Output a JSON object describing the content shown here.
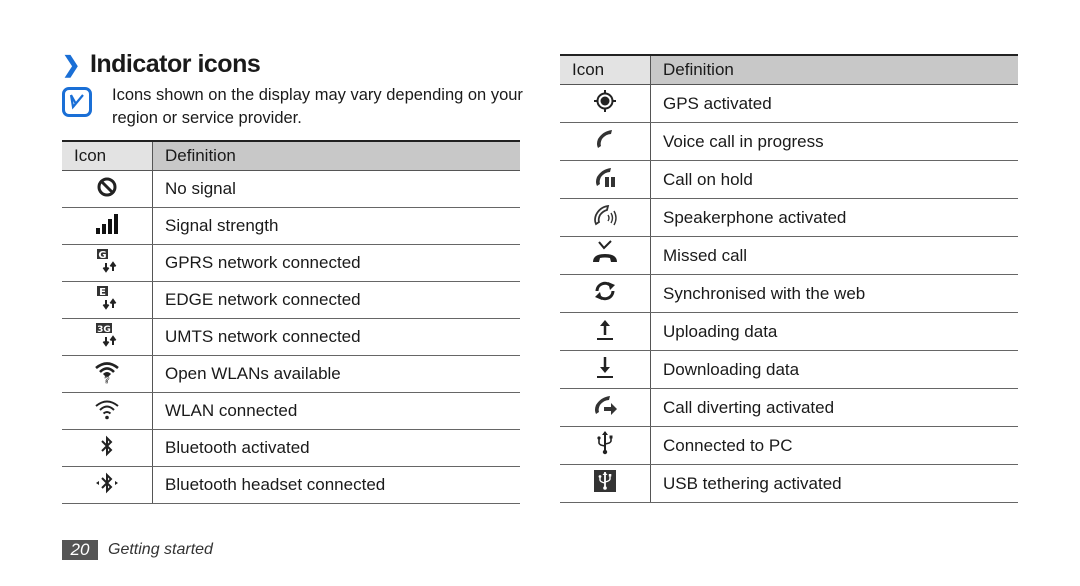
{
  "section": {
    "title_marker": "❯",
    "title": "Indicator icons",
    "note_icon": "note-pencil-icon",
    "note_text": "Icons shown on the display may vary depending on your region or service provider."
  },
  "table_headers": {
    "icon": "Icon",
    "definition": "Definition"
  },
  "left_table": [
    {
      "icon": "no-signal-icon",
      "definition": "No signal"
    },
    {
      "icon": "signal-strength-icon",
      "definition": "Signal strength"
    },
    {
      "icon": "gprs-icon",
      "definition": "GPRS network connected"
    },
    {
      "icon": "edge-icon",
      "definition": "EDGE network connected"
    },
    {
      "icon": "umts-icon",
      "definition": "UMTS network connected"
    },
    {
      "icon": "open-wlan-icon",
      "definition": "Open WLANs available"
    },
    {
      "icon": "wlan-icon",
      "definition": "WLAN connected"
    },
    {
      "icon": "bluetooth-icon",
      "definition": "Bluetooth activated"
    },
    {
      "icon": "bluetooth-headset-icon",
      "definition": "Bluetooth headset connected"
    }
  ],
  "right_table": [
    {
      "icon": "gps-icon",
      "definition": "GPS activated"
    },
    {
      "icon": "voice-call-icon",
      "definition": "Voice call in progress"
    },
    {
      "icon": "call-hold-icon",
      "definition": "Call on hold"
    },
    {
      "icon": "speakerphone-icon",
      "definition": "Speakerphone activated"
    },
    {
      "icon": "missed-call-icon",
      "definition": "Missed call"
    },
    {
      "icon": "sync-icon",
      "definition": "Synchronised with the web"
    },
    {
      "icon": "upload-icon",
      "definition": "Uploading data"
    },
    {
      "icon": "download-icon",
      "definition": "Downloading data"
    },
    {
      "icon": "call-divert-icon",
      "definition": "Call diverting activated"
    },
    {
      "icon": "usb-icon",
      "definition": "Connected to PC"
    },
    {
      "icon": "usb-tethering-icon",
      "definition": "USB tethering activated"
    }
  ],
  "footer": {
    "page_number": "20",
    "chapter": "Getting started"
  },
  "colors": {
    "accent": "#1a6fd6",
    "header_icon_bg": "#e3e3e3",
    "header_def_bg": "#c8c8c8",
    "footer_badge": "#555555"
  }
}
